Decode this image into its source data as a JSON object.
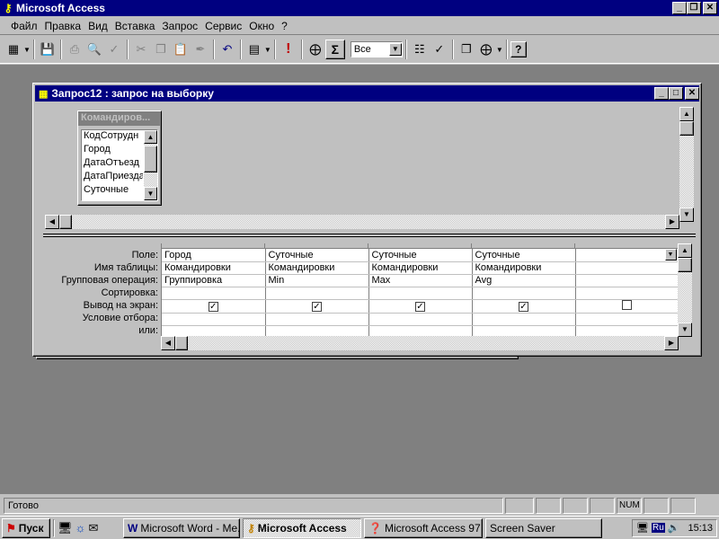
{
  "app": {
    "title": "Microsoft Access"
  },
  "menu": [
    "Файл",
    "Правка",
    "Вид",
    "Вставка",
    "Запрос",
    "Сервис",
    "Окно",
    "?"
  ],
  "toolbar": {
    "query_type_value": "Все",
    "sigma": "Σ",
    "exclaim": "!",
    "help": "?"
  },
  "query_window": {
    "title": "Запрос12 : запрос на выборку"
  },
  "table_box": {
    "title": "Командиров...",
    "fields": [
      "КодСотрудн",
      "Город",
      "ДатаОтъезд",
      "ДатаПриезда",
      "Суточные"
    ]
  },
  "grid": {
    "row_labels": [
      "Поле:",
      "Имя таблицы:",
      "Групповая операция:",
      "Сортировка:",
      "Вывод на экран:",
      "Условие отбора:",
      "или:"
    ],
    "columns": [
      {
        "field": "Город",
        "table": "Командировки",
        "group": "Группировка",
        "sort": "",
        "show": true
      },
      {
        "field": "Суточные",
        "table": "Командировки",
        "group": "Min",
        "sort": "",
        "show": true
      },
      {
        "field": "Суточные",
        "table": "Командировки",
        "group": "Max",
        "sort": "",
        "show": true
      },
      {
        "field": "Суточные",
        "table": "Командировки",
        "group": "Avg",
        "sort": "",
        "show": true
      },
      {
        "field": "",
        "table": "",
        "group": "",
        "sort": "",
        "show": false
      }
    ]
  },
  "status": {
    "text": "Готово",
    "num": "NUM"
  },
  "taskbar": {
    "start": "Пуск",
    "tasks": [
      "Microsoft Word - Me...",
      "Microsoft Access",
      "Microsoft Access 97",
      "Screen Saver"
    ],
    "lang": "Ru",
    "clock": "15:13"
  }
}
